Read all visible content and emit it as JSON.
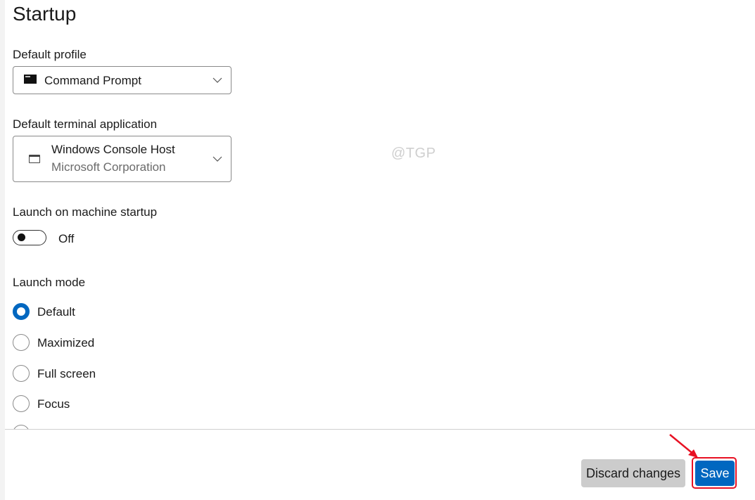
{
  "page": {
    "title": "Startup",
    "watermark": "@TGP"
  },
  "default_profile": {
    "label": "Default profile",
    "selected": "Command Prompt",
    "icon": "command-prompt-icon"
  },
  "default_terminal": {
    "label": "Default terminal application",
    "selected_name": "Windows Console Host",
    "selected_publisher": "Microsoft Corporation",
    "icon": "console-host-icon"
  },
  "launch_on_startup": {
    "label": "Launch on machine startup",
    "state": "Off",
    "enabled": false
  },
  "launch_mode": {
    "label": "Launch mode",
    "selected": "Default",
    "options": [
      {
        "label": "Default",
        "checked": true
      },
      {
        "label": "Maximized",
        "checked": false
      },
      {
        "label": "Full screen",
        "checked": false
      },
      {
        "label": "Focus",
        "checked": false
      }
    ]
  },
  "footer": {
    "discard_label": "Discard changes",
    "save_label": "Save"
  },
  "annotation": {
    "color": "#e81123",
    "target": "Save"
  },
  "colors": {
    "accent": "#0067c0",
    "discard_bg": "#cccccc"
  }
}
